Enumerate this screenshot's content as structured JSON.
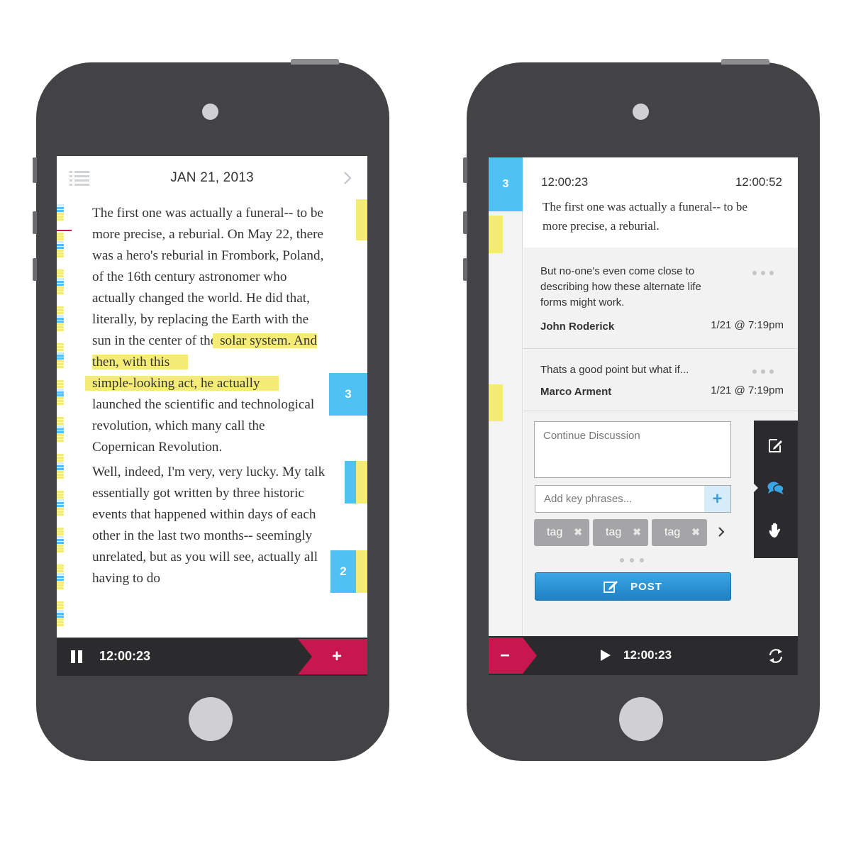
{
  "colors": {
    "accent_pink": "#c8174f",
    "accent_blue": "#4fc1f2",
    "highlight_yellow": "#f5ec78",
    "post_blue": "#1f81c4",
    "phone_body": "#434345"
  },
  "left_phone": {
    "header": {
      "date": "JAN 21, 2013",
      "menu_icon": "list-icon",
      "next_icon": "chevron-right-icon"
    },
    "article": {
      "paragraph1_before": "The first one was actually a funeral-- to be more precise, a reburial. On May 22, there was a hero's reburial in Frombork, Poland, of the 16th century astronomer who actually changed the world. He did that, literally, by replacing the Earth with the sun in the center of the ",
      "paragraph1_highlight_1": "solar system. And then, with this",
      "paragraph1_highlight_2": "simple-looking act, he actually",
      "paragraph1_after": "launched the scientific and technological revolution, which many call the Copernican Revolution.",
      "paragraph2": "Well, indeed, I'm very, very lucky. My talk essentially got written by three historic events that happened within days of each other in the last two months-- seemingly unrelated, but as you will see, actually all having to do"
    },
    "markers": {
      "count_a": "3",
      "count_b": "2"
    },
    "bottom_bar": {
      "time": "12:00:23",
      "pause_icon": "pause-icon",
      "add_label": "+"
    }
  },
  "right_phone": {
    "strip": {
      "count": "3"
    },
    "quote": {
      "start_time": "12:00:23",
      "end_time": "12:00:52",
      "text": "The first one was actually a funeral-- to be more precise, a reburial."
    },
    "comments": [
      {
        "text": "But no-one's even come close to describing how these alternate life forms might work.",
        "author": "John Roderick",
        "time": "1/21 @ 7:19pm"
      },
      {
        "text": "Thats a good point but what if...",
        "author": "Marco Arment",
        "time": "1/21 @ 7:19pm"
      }
    ],
    "discussion": {
      "placeholder": "Continue Discussion"
    },
    "key_phrases": {
      "placeholder": "Add key phrases...",
      "add_label": "+"
    },
    "tags": [
      {
        "label": "tag"
      },
      {
        "label": "tag"
      },
      {
        "label": "tag"
      }
    ],
    "tag_remove_label": "✖",
    "post_button": {
      "label": "POST",
      "icon": "edit-icon"
    },
    "tools": [
      "edit-note-icon",
      "chat-bubbles-icon",
      "raise-hand-icon"
    ],
    "bottom_bar": {
      "minus_label": "−",
      "time": "12:00:23",
      "play_icon": "play-icon",
      "sync_icon": "refresh-icon"
    }
  }
}
